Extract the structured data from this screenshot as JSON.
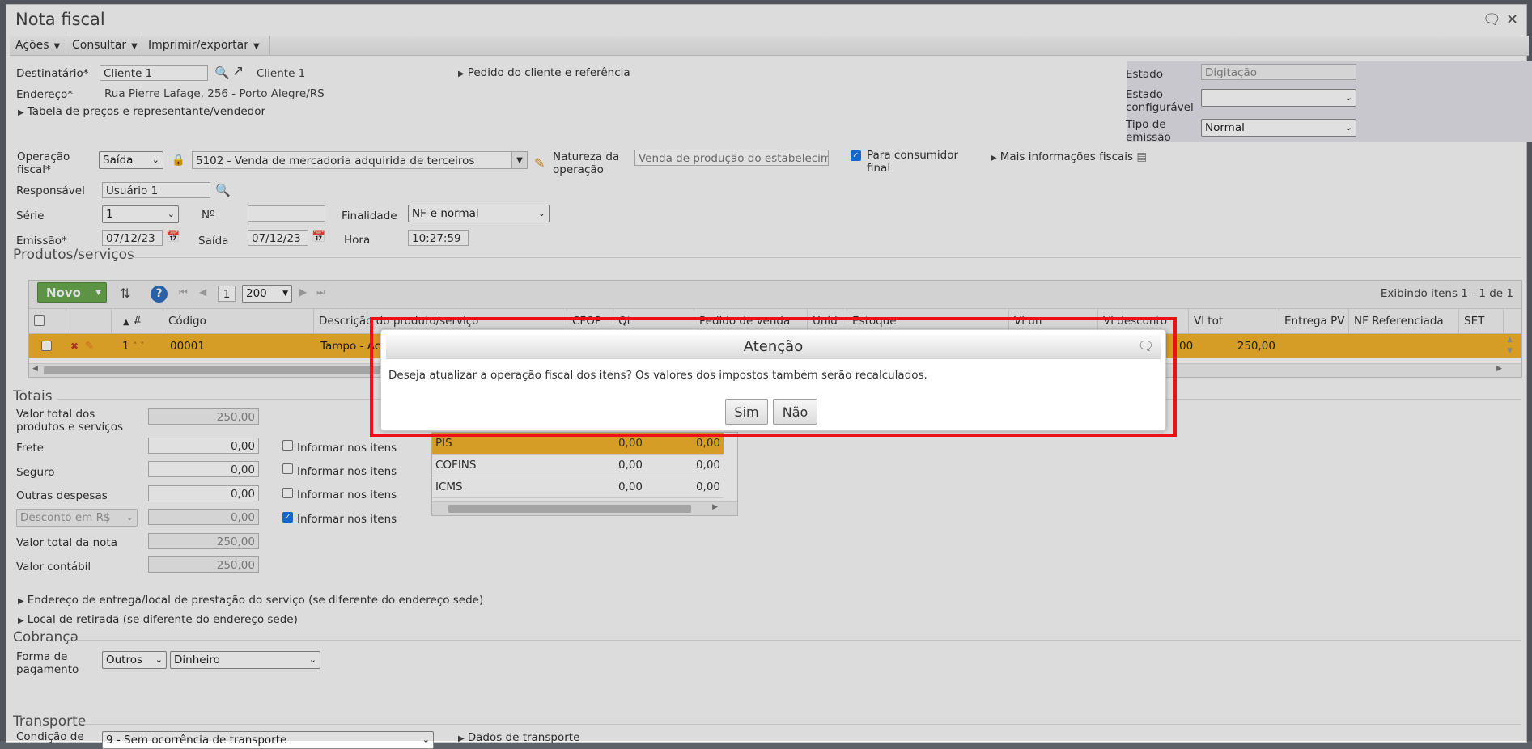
{
  "window": {
    "title": "Nota fiscal"
  },
  "menu": [
    {
      "label": "Ações"
    },
    {
      "label": "Consultar"
    },
    {
      "label": "Imprimir/exportar"
    }
  ],
  "header": {
    "destinatario_label": "Destinatário*",
    "destinatario_value": "Cliente 1",
    "destinatario_link": "Cliente 1",
    "endereco_label": "Endereço*",
    "endereco_value": "Rua Pierre Lafage, 256 - Porto Alegre/RS",
    "tabela_precos": "Tabela de preços e representante/vendedor",
    "pedido_cliente": "Pedido do cliente e referência"
  },
  "status": {
    "estado_label": "Estado",
    "estado_value": "Digitação",
    "estado_config_label_1": "Estado",
    "estado_config_label_2": "configurável",
    "estado_config_value": "",
    "tipo_emissao_label_1": "Tipo de",
    "tipo_emissao_label_2": "emissão",
    "tipo_emissao_value": "Normal"
  },
  "fiscal": {
    "operacao_label_1": "Operação",
    "operacao_label_2": "fiscal*",
    "operacao_value": "Saída",
    "cfop_value": "5102 - Venda de mercadoria adquirida de terceiros",
    "natureza_label_1": "Natureza da",
    "natureza_label_2": "operação",
    "natureza_value": "Venda de produção do estabelecime",
    "consumidor_label_1": "Para consumidor",
    "consumidor_label_2": "final",
    "mais_info": "Mais informações fiscais",
    "responsavel_label": "Responsável",
    "responsavel_value": "Usuário 1",
    "serie_label": "Série",
    "serie_value": "1",
    "numero_label": "Nº",
    "numero_value": "",
    "finalidade_label": "Finalidade",
    "finalidade_value": "NF-e normal",
    "emissao_label": "Emissão*",
    "emissao_value": "07/12/23",
    "saida_label": "Saída",
    "saida_value": "07/12/23",
    "hora_label": "Hora",
    "hora_value": "10:27:59"
  },
  "produtos": {
    "section": "Produtos/serviços",
    "novo": "Novo",
    "page": "1",
    "page_size": "200",
    "exibindo": "Exibindo itens 1 - 1 de 1",
    "columns": [
      "#",
      "Código",
      "Descrição do produto/serviço",
      "CFOP",
      "Qt",
      "Pedido de venda",
      "Unid",
      "Estoque",
      "Vl un",
      "Vl desconto",
      "Vl tot",
      "Entrega PV",
      "NF Referenciada",
      "SET"
    ],
    "row": {
      "num": "1",
      "codigo": "00001",
      "descricao": "Tampo - Ac",
      "desconto_tail": "00",
      "vl_tot": "250,00"
    }
  },
  "totais": {
    "section": "Totais",
    "valor_total_prod_1": "Valor total dos",
    "valor_total_prod_2": "produtos e serviços",
    "valor_total_prod_value": "250,00",
    "frete_label": "Frete",
    "frete_value": "0,00",
    "seguro_label": "Seguro",
    "seguro_value": "0,00",
    "outras_label": "Outras despesas",
    "outras_value": "0,00",
    "desconto_select": "Desconto em R$",
    "desconto_value": "0,00",
    "valor_nota_label": "Valor total da nota",
    "valor_nota_value": "250,00",
    "valor_contabil_label": "Valor contábil",
    "valor_contabil_value": "250,00",
    "informar_label": "Informar nos itens"
  },
  "impostos": [
    {
      "name": "PIS",
      "v1": "0,00",
      "v2": "0,00"
    },
    {
      "name": "COFINS",
      "v1": "0,00",
      "v2": "0,00"
    },
    {
      "name": "ICMS",
      "v1": "0,00",
      "v2": "0,00"
    }
  ],
  "outros": {
    "endereco_entrega": "Endereço de entrega/local de prestação do serviço (se diferente do endereço sede)",
    "local_retirada": "Local de retirada (se diferente do endereço sede)",
    "cobranca_section": "Cobrança",
    "forma_pag_label_1": "Forma de",
    "forma_pag_label_2": "pagamento",
    "forma_pag_value": "Outros",
    "forma_pag_value2": "Dinheiro",
    "transporte_section": "Transporte",
    "condicao_label": "Condição de",
    "condicao_value": "9 - Sem ocorrência de transporte",
    "dados_transporte": "Dados de transporte"
  },
  "dialog": {
    "title": "Atenção",
    "message": "Deseja atualizar a operação fiscal dos itens? Os valores dos impostos também serão recalculados.",
    "yes": "Sim",
    "no": "Não"
  }
}
